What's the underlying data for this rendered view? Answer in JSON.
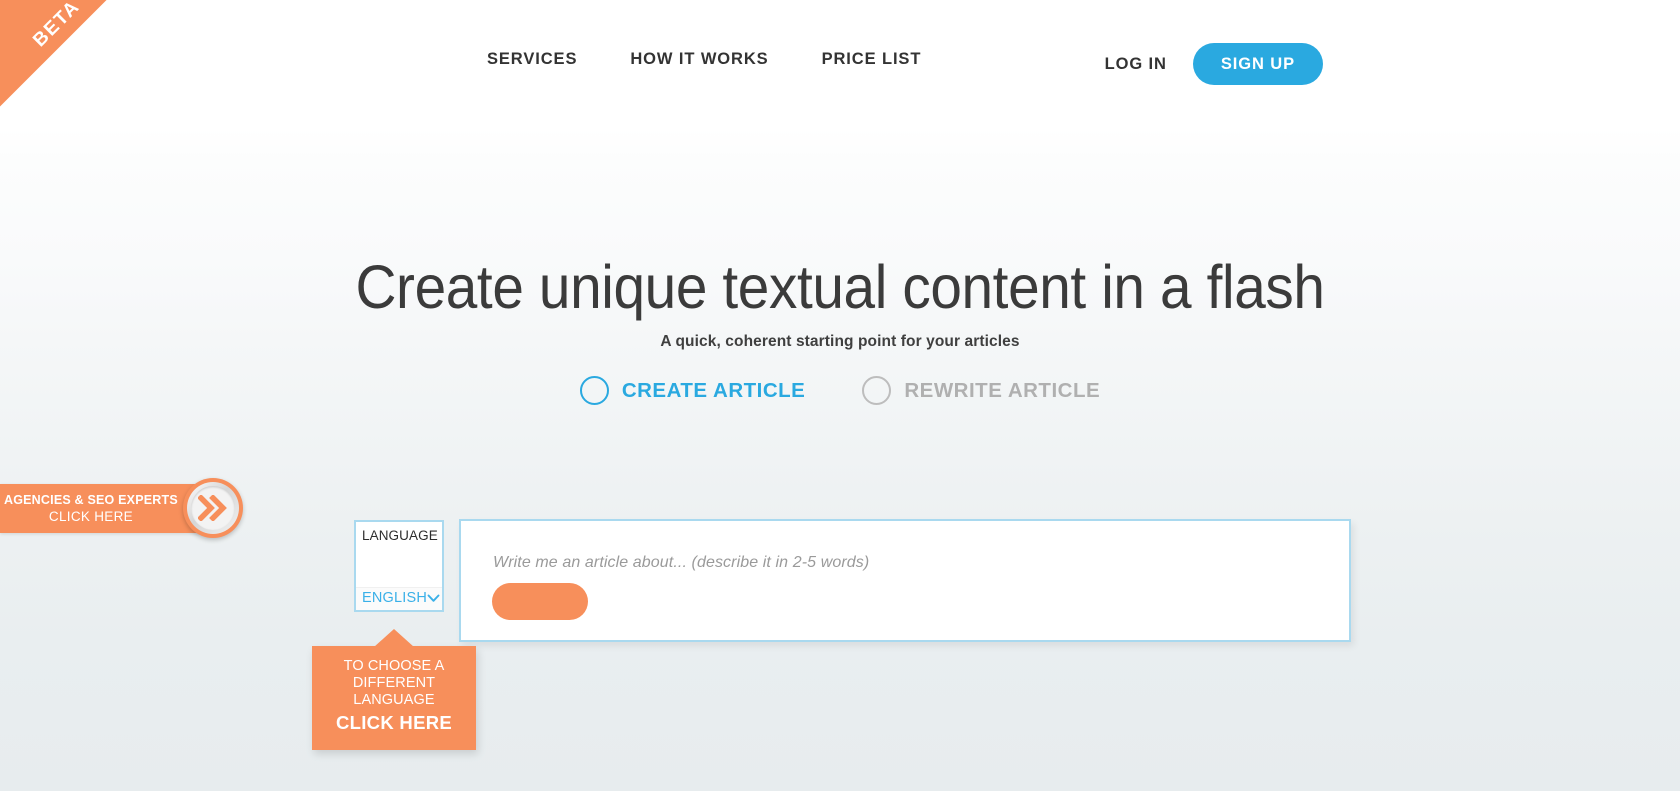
{
  "badge": {
    "beta_label": "BETA"
  },
  "header": {
    "nav": [
      {
        "label": "SERVICES",
        "name": "nav-services"
      },
      {
        "label": "HOW IT WORKS",
        "name": "nav-how-it-works"
      },
      {
        "label": "PRICE LIST",
        "name": "nav-price-list"
      }
    ],
    "login_label": "LOG IN",
    "signup_label": "SIGN UP",
    "accent_color": "#2aa9e0"
  },
  "hero": {
    "title": "Create unique textual content in a flash",
    "subtitle": "A quick, coherent starting point for your articles"
  },
  "modes": [
    {
      "label": "CREATE ARTICLE",
      "selected": true
    },
    {
      "label": "REWRITE ARTICLE",
      "selected": false
    }
  ],
  "side_tab": {
    "line1": "AGENCIES & SEO EXPERTS",
    "line2": "CLICK HERE",
    "icon": "double-chevron-right-icon",
    "color": "#f78f5b"
  },
  "language": {
    "title": "LANGUAGE",
    "selected": "ENGLISH",
    "caret_icon": "chevron-down-icon"
  },
  "tooltip": {
    "line1": "TO CHOOSE A",
    "line2": "DIFFERENT LANGUAGE",
    "line3": "CLICK HERE",
    "color": "#f78f5b"
  },
  "article_input": {
    "placeholder": "Write me an article about... (describe it in 2-5 words)",
    "value": "",
    "submit_label": "",
    "submit_color": "#f78f5b"
  }
}
